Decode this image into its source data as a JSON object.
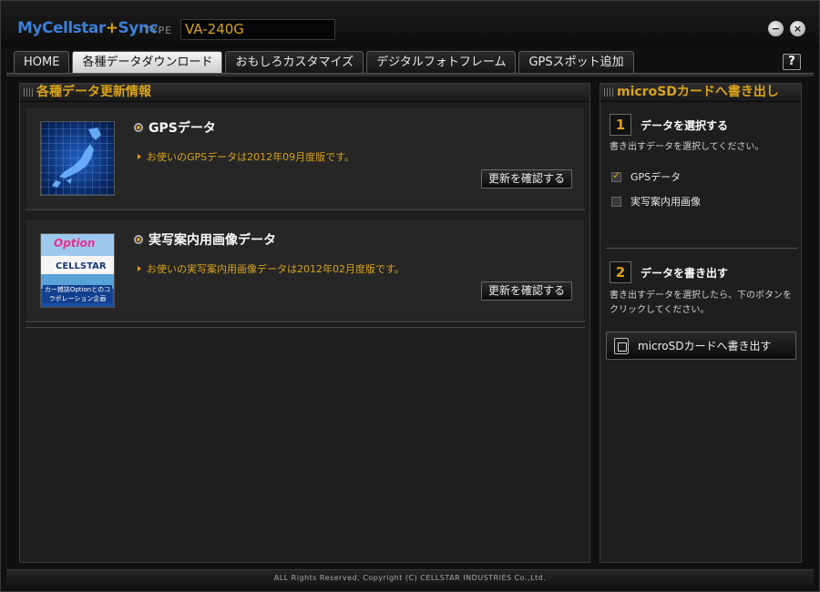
{
  "app": {
    "logo_text": "MyCellstar",
    "logo_plus": "+",
    "logo_sync": "Sync",
    "type_label": "TYPE",
    "type_value": "VA-240G"
  },
  "window": {
    "minimize_icon": "minimize-icon",
    "close_icon": "close-icon"
  },
  "tabs": [
    {
      "label": "HOME",
      "active": false
    },
    {
      "label": "各種データダウンロード",
      "active": true
    },
    {
      "label": "おもしろカスタマイズ",
      "active": false
    },
    {
      "label": "デジタルフォトフレーム",
      "active": false
    },
    {
      "label": "GPSスポット追加",
      "active": false
    }
  ],
  "help_label": "?",
  "left_panel": {
    "title": "各種データ更新情報",
    "items": [
      {
        "title": "GPSデータ",
        "info": "お使いのGPSデータは2012年09月度版です。",
        "button": "更新を確認する"
      },
      {
        "title": "実写案内用画像データ",
        "info": "お使いの実写案内用画像データは2012年02月度版です。",
        "button": "更新を確認する"
      }
    ]
  },
  "thumb_photo": {
    "option": "Option",
    "cellstar": "CELLSTAR",
    "band": "カー雑誌Optionとのコラボレーション企画"
  },
  "right_panel": {
    "title": "microSDカードへ書き出し",
    "step1": {
      "num": "1",
      "label": "データを選択する",
      "desc": "書き出すデータを選択してください。"
    },
    "checkboxes": [
      {
        "label": "GPSデータ",
        "checked": true
      },
      {
        "label": "実写案内用画像",
        "checked": false
      }
    ],
    "step2": {
      "num": "2",
      "label": "データを書き出す",
      "desc": "書き出すデータを選択したら、下のボタンをクリックしてください。"
    },
    "write_button": "microSDカードへ書き出す"
  },
  "footer": "ALL Rights Reserved, Copyright (C) CELLSTAR INDUSTRIES Co.,Ltd.",
  "colors": {
    "accent": "#d9a21a",
    "logo_blue": "#3a7fd6",
    "background": "#101010"
  }
}
